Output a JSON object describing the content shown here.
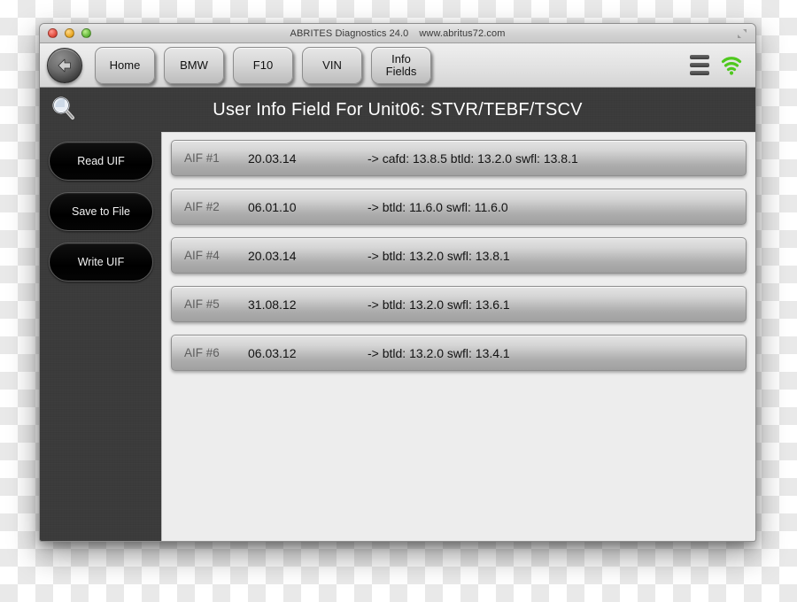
{
  "window": {
    "title": "ABRITES Diagnostics 24.0",
    "site": "www.abritus72.com",
    "traffic_lights": [
      "close",
      "minimize",
      "zoom"
    ],
    "expand_icon": "fullscreen-icon"
  },
  "toolbar": {
    "back_icon": "back-arrow-icon",
    "tabs": [
      {
        "label": "Home"
      },
      {
        "label": "BMW"
      },
      {
        "label": "F10"
      },
      {
        "label": "VIN"
      },
      {
        "label": "Info\nFields"
      }
    ],
    "menu_icon": "hamburger-menu-icon",
    "wifi_icon": "wifi-signal-icon",
    "wifi_color": "#4fc81e"
  },
  "header": {
    "search_icon": "magnifier-icon",
    "page_title": "User Info Field For Unit06: STVR/TEBF/TSCV"
  },
  "sidebar": {
    "buttons": [
      {
        "label": "Read UIF"
      },
      {
        "label": "Save to File"
      },
      {
        "label": "Write UIF"
      }
    ]
  },
  "content": {
    "rows": [
      {
        "id": "AIF #1",
        "date": "20.03.14",
        "info": "-> cafd: 13.8.5 btld: 13.2.0 swfl: 13.8.1"
      },
      {
        "id": "AIF #2",
        "date": "06.01.10",
        "info": "-> btld: 11.6.0 swfl: 11.6.0"
      },
      {
        "id": "AIF #4",
        "date": "20.03.14",
        "info": "-> btld: 13.2.0 swfl: 13.8.1"
      },
      {
        "id": "AIF #5",
        "date": "31.08.12",
        "info": "-> btld: 13.2.0 swfl: 13.6.1"
      },
      {
        "id": "AIF #6",
        "date": "06.03.12",
        "info": "-> btld: 13.2.0 swfl: 13.4.1"
      }
    ]
  },
  "colors": {
    "dark_panel": "#3a3a3a",
    "content_bg": "#ededed",
    "accent_green": "#4fc81e"
  }
}
